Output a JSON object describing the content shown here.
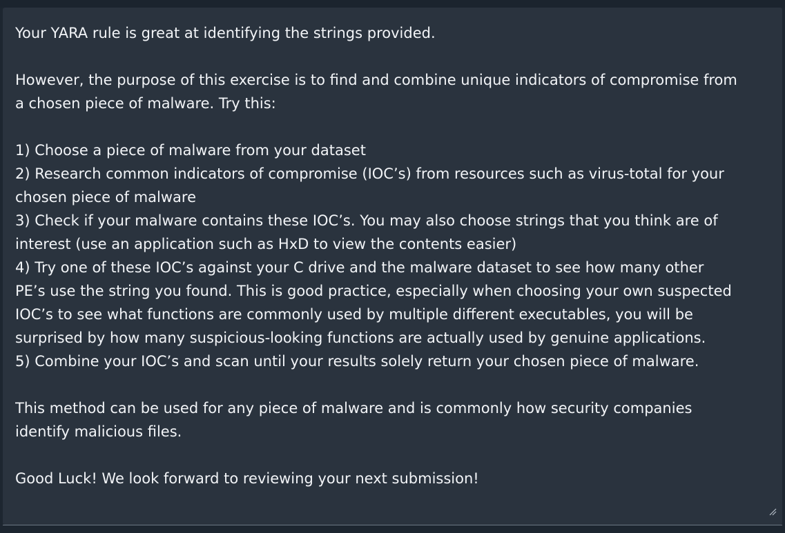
{
  "feedback": {
    "lines": [
      "Your YARA rule is great at identifying the strings provided.",
      "",
      "However, the purpose of this exercise is to find and combine unique indicators of compromise from",
      "a chosen piece of malware. Try this:",
      "",
      "1) Choose a piece of malware from your dataset",
      "2) Research common indicators of compromise (IOC’s) from resources such as virus-total for your",
      "chosen piece of malware",
      "3) Check if your malware contains these IOC’s. You may also choose strings that you think are of",
      "interest (use an application such as HxD to view the contents easier)",
      "4) Try one of these IOC’s against your C drive and the malware dataset to see how many other",
      "PE’s use the string you found. This is good practice, especially when choosing your own suspected",
      "IOC’s to see what functions are commonly used by multiple different executables, you will be",
      "surprised by how many suspicious-looking functions are actually used by genuine applications.",
      "5) Combine your IOC’s and scan until your results solely return your chosen piece of malware.",
      "",
      "This method can be used for any piece of malware and is commonly how security companies",
      "identify malicious files.",
      "",
      "Good Luck! We look forward to reviewing your next submission!"
    ]
  },
  "icons": {
    "resize": "resize-grip-icon"
  },
  "colors": {
    "background": "#1d2630",
    "textarea": "#2a333e",
    "text": "#f2f4f7"
  }
}
